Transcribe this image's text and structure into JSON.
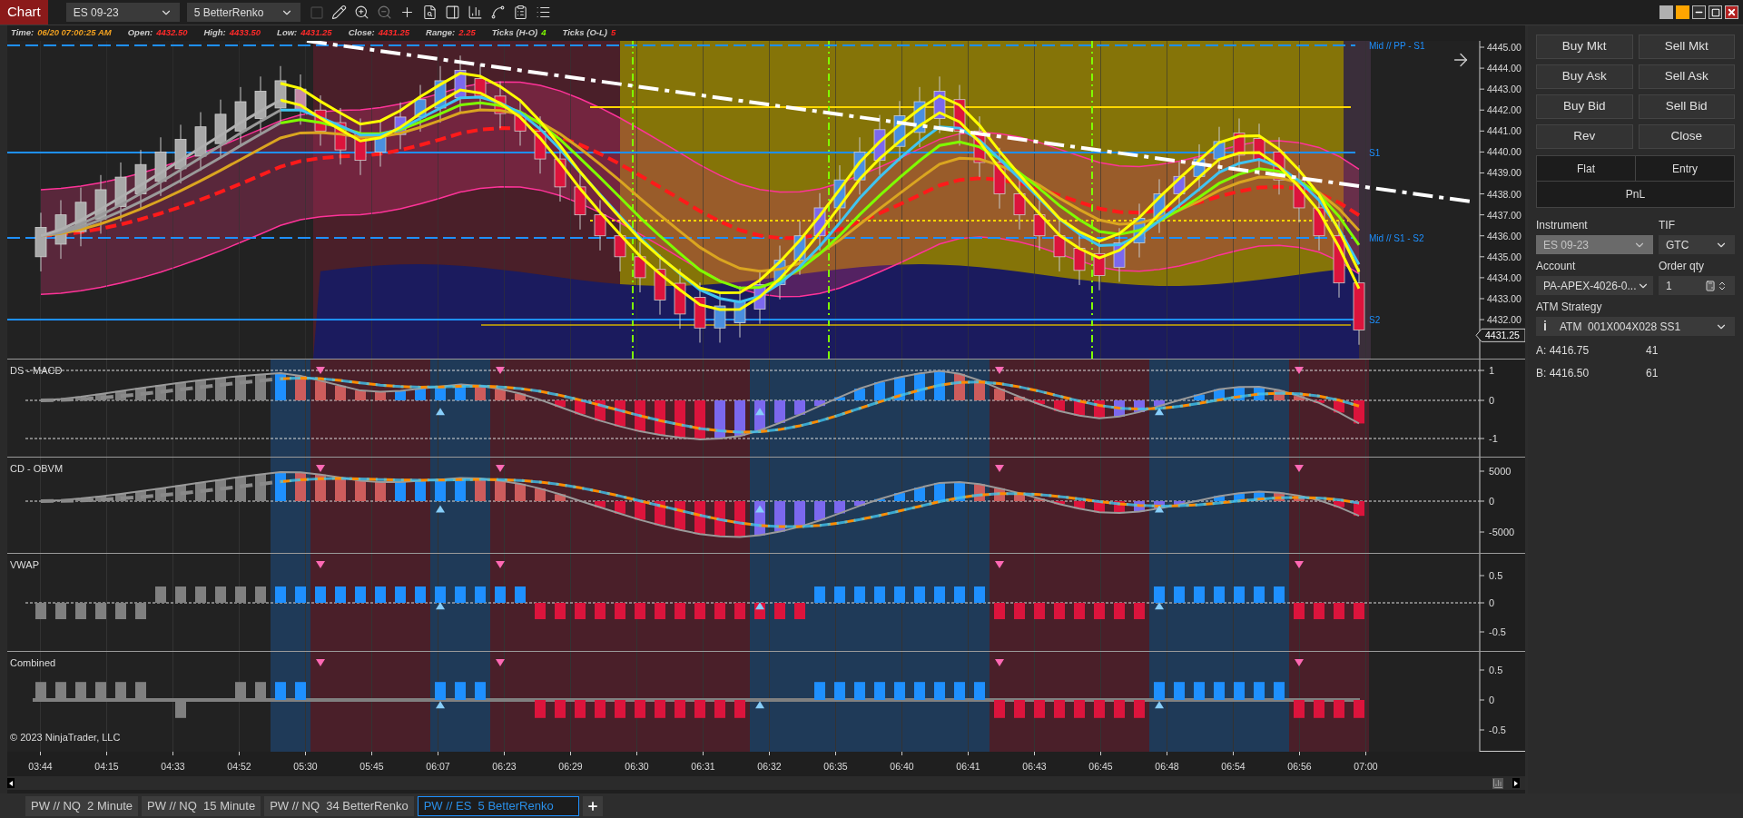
{
  "toolbar": {
    "title": "Chart",
    "instrument": "ES 09-23",
    "bar_type": "5 BetterRenko"
  },
  "info_bar": [
    {
      "label": "Time:",
      "value": "06/20 07:00:25 AM",
      "kind": "time"
    },
    {
      "label": "Open:",
      "value": "4432.50",
      "kind": "price"
    },
    {
      "label": "High:",
      "value": "4433.50",
      "kind": "price"
    },
    {
      "label": "Low:",
      "value": "4431.25",
      "kind": "price"
    },
    {
      "label": "Close:",
      "value": "4431.25",
      "kind": "price"
    },
    {
      "label": "Range:",
      "value": "2.25",
      "kind": "price"
    },
    {
      "label": "Ticks (H-O)",
      "value": "4",
      "kind": "up"
    },
    {
      "label": "Ticks (O-L)",
      "value": "5",
      "kind": "down"
    }
  ],
  "price_pane": {
    "axis_labels": [
      "4445.00",
      "4444.00",
      "4443.00",
      "4442.00",
      "4441.00",
      "4440.00",
      "4439.00",
      "4438.00",
      "4437.00",
      "4436.00",
      "4435.00",
      "4434.00",
      "4433.00",
      "4432.00"
    ],
    "current_price": "4431.25",
    "level_labels": [
      {
        "text": "Mid // PP - S1",
        "kind": "mid_pp_s1"
      },
      {
        "text": "S1",
        "kind": "s1"
      },
      {
        "text": "Mid // S1 - S2",
        "kind": "mid_s1_s2"
      },
      {
        "text": "S2",
        "kind": "s2"
      }
    ]
  },
  "indicator_panes": [
    {
      "title": "DS - MACD",
      "kind": "macd",
      "axis_labels": [
        "1",
        "0",
        "-1"
      ]
    },
    {
      "title": "CD - OBVM",
      "kind": "obvm",
      "axis_labels": [
        "5000",
        "0",
        "-5000"
      ]
    },
    {
      "title": "VWAP",
      "kind": "vwap",
      "axis_labels": [
        "0.5",
        "0",
        "-0.5"
      ]
    },
    {
      "title": "Combined",
      "kind": "combined",
      "axis_labels": [
        "0.5",
        "0",
        "-0.5"
      ]
    }
  ],
  "copyright": "© 2023 NinjaTrader, LLC",
  "time_axis": [
    "03:44",
    "04:15",
    "04:33",
    "04:52",
    "05:30",
    "05:45",
    "06:07",
    "06:23",
    "06:29",
    "06:30",
    "06:31",
    "06:32",
    "06:35",
    "06:40",
    "06:41",
    "06:43",
    "06:45",
    "06:48",
    "06:54",
    "06:56",
    "07:00"
  ],
  "chart_tabs": [
    {
      "label": "PW // NQ  2 Minute",
      "selected": false
    },
    {
      "label": "PW // NQ  15 Minute",
      "selected": false
    },
    {
      "label": "PW // NQ  34 BetterRenko",
      "selected": false
    },
    {
      "label": "PW // ES  5 BetterRenko",
      "selected": true
    }
  ],
  "order_panel": {
    "buttons": [
      "Buy Mkt",
      "Sell Mkt",
      "Buy Ask",
      "Sell Ask",
      "Buy Bid",
      "Sell Bid",
      "Rev",
      "Close"
    ],
    "flat": "Flat",
    "entry": "Entry",
    "pnl": "PnL",
    "instrument": {
      "label": "Instrument",
      "value": "ES 09-23",
      "disabled": true
    },
    "tif": {
      "label": "TIF",
      "value": "GTC"
    },
    "account": {
      "label": "Account",
      "value": "PA-APEX-4026-0..."
    },
    "order_qty": {
      "label": "Order qty",
      "value": "1"
    },
    "atm_strategy": {
      "label": "ATM Strategy",
      "icon": "i",
      "value": "ATM  001X004X028 SS1"
    },
    "ask": {
      "label": "A:",
      "price": "4416.75",
      "size": "41"
    },
    "bid": {
      "label": "B:",
      "price": "4416.50",
      "size": "61"
    }
  }
}
